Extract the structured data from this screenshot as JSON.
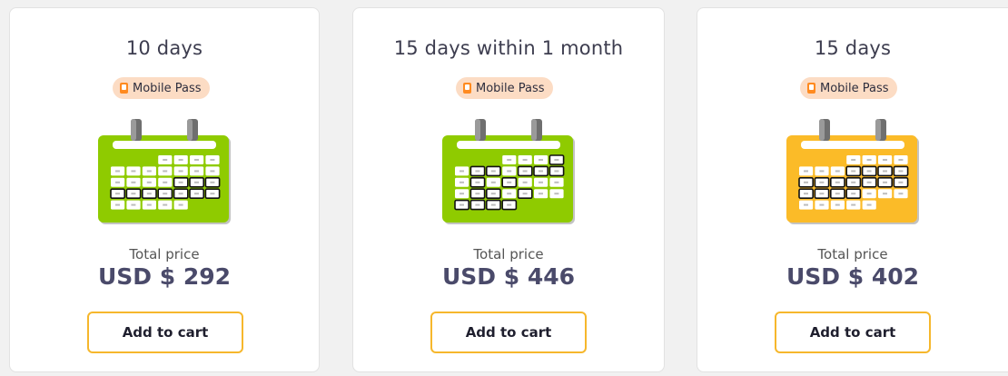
{
  "cards": [
    {
      "title": "10 days",
      "badge": "Mobile Pass",
      "price_label": "Total price",
      "price": "USD $ 292",
      "button": "Add to cart",
      "calendar_color": "#8fcb00",
      "calendar_icon": "calendar-10-days-icon"
    },
    {
      "title": "15 days within 1 month",
      "badge": "Mobile Pass",
      "price_label": "Total price",
      "price": "USD $ 446",
      "button": "Add to cart",
      "calendar_color": "#8fcb00",
      "calendar_icon": "calendar-15-days-within-month-icon"
    },
    {
      "title": "15 days",
      "badge": "Mobile Pass",
      "price_label": "Total price",
      "price": "USD $ 402",
      "button": "Add to cart",
      "calendar_color": "#fbbb28",
      "calendar_icon": "calendar-15-days-icon"
    }
  ],
  "colors": {
    "badge_bg": "#fcdcc4",
    "badge_icon": "#ff8a1f",
    "button_border": "#f6b72c",
    "price_text": "#4a4a6a"
  }
}
